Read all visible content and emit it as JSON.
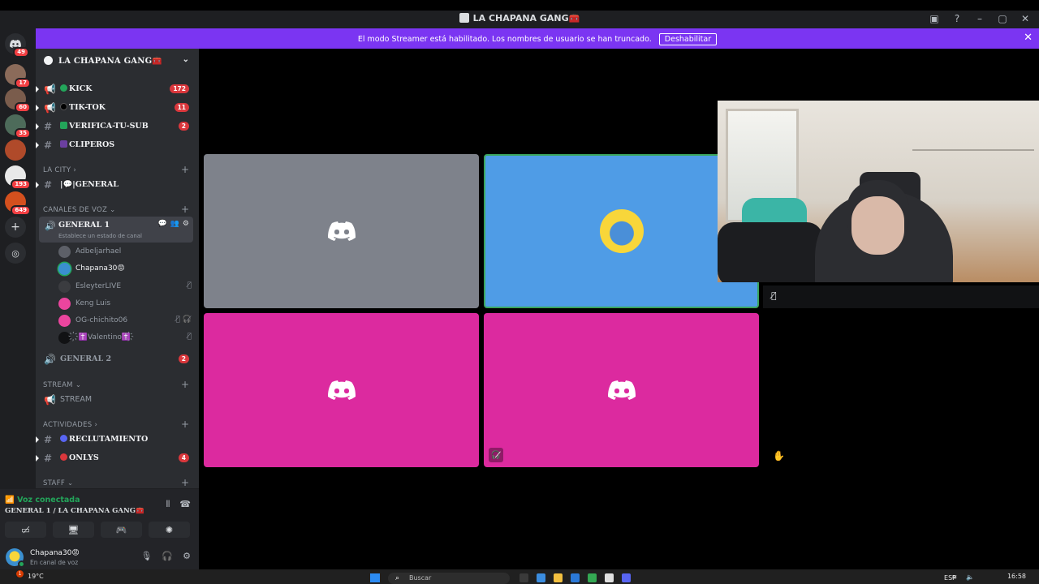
{
  "window": {
    "title": "LA CHAPANA GANG🧰"
  },
  "banner": {
    "message": "El modo Streamer está habilitado. Los nombres de usuario se han truncado.",
    "button": "Deshabilitar"
  },
  "servers": {
    "home_badge": "49",
    "items": [
      {
        "badge": "17",
        "color": "#8b6b5a"
      },
      {
        "badge": "60",
        "color": "#7a5c4c"
      },
      {
        "badge": "35",
        "color": "#4d6b5a"
      },
      {
        "badge": "",
        "color": "#b04a2a"
      },
      {
        "badge": "193",
        "color": "#e9e9e9"
      },
      {
        "badge": "649",
        "color": "#d4501e"
      }
    ]
  },
  "guild": {
    "name": "LA CHAPANA GANG🧰"
  },
  "channels": {
    "kick": {
      "name": "KICK",
      "badge": "172"
    },
    "tiktok": {
      "name": "TIK-TOK",
      "badge": "11"
    },
    "verifica": {
      "name": "VERIFICA-TU-SUB",
      "badge": "2"
    },
    "clipero": {
      "name": "CLIPEROS"
    }
  },
  "categories": {
    "la_city": "LA CITY",
    "voz": "CANALES DE VOZ",
    "stream": "STREAM",
    "actividades": "ACTIVIDADES",
    "staff": "STAFF"
  },
  "general_text": {
    "name": "|💬|GENERAL"
  },
  "voice_general1": {
    "name": "GENERAL 1",
    "status": "Establece un estado de canal"
  },
  "voice_users": [
    {
      "name": "Adbeljarhael",
      "color": "#5d6068",
      "active": false
    },
    {
      "name": "Chapana30😡",
      "color": "#3a8fd0",
      "active": true
    },
    {
      "name": "EsleyterLIVE",
      "color": "#3b3c40",
      "active": false
    },
    {
      "name": "Keng Luis",
      "color": "#eb459e",
      "active": false
    },
    {
      "name": "OG-chichito06",
      "color": "#eb459e",
      "active": false
    },
    {
      "name": "҉✝️Valentino✝️҉",
      "color": "#111214",
      "active": false
    }
  ],
  "voice_general2": {
    "name": "GENERAL 2",
    "badge": "2"
  },
  "stream_channel": {
    "name": "STREAM"
  },
  "reclutamiento": {
    "name": "RECLUTAMIENTO"
  },
  "onlys": {
    "name": "ONLYS",
    "badge": "4"
  },
  "voice_panel": {
    "status": "Voz conectada",
    "location": "GENERAL 1 / LA CHAPANA GANG🧰"
  },
  "user": {
    "name": "Chapana30😡",
    "status": "En canal de voz"
  },
  "tiles_colors": {
    "gray": "#7e828b",
    "blue": "#4f9ce6",
    "pink": "#dc2a9f",
    "selected": "#3ba55d"
  },
  "taskbar": {
    "weather": "19°C",
    "weather_badge": "1",
    "search_placeholder": "Buscar",
    "lang": "ESP",
    "time": "16:58"
  }
}
